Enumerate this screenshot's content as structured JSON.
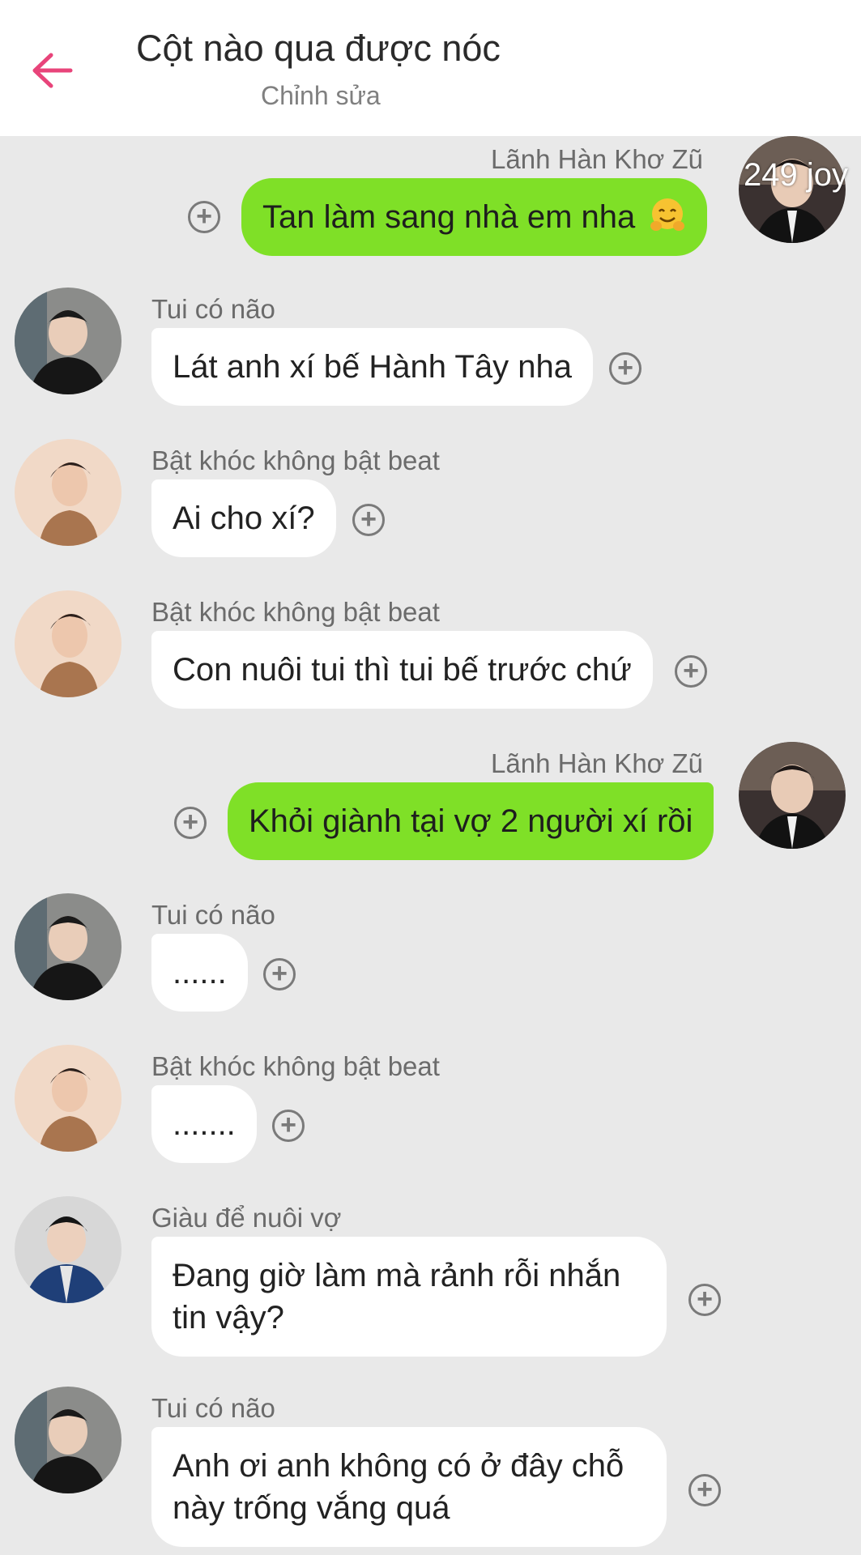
{
  "header": {
    "title": "Cột nào qua được nóc",
    "subtitle": "Chỉnh sửa",
    "accent_color": "#e8447a"
  },
  "colors": {
    "background": "#e9e9e9",
    "outgoing_bubble": "#7fe027",
    "incoming_bubble": "#ffffff"
  },
  "badge": {
    "text": "249 joy"
  },
  "messages": [
    {
      "sender": "Lãnh Hàn Khơ Zũ",
      "text": "Tan làm sang nhà em nha",
      "direction": "outgoing",
      "emoji": "hugging-face-emoji"
    },
    {
      "sender": "Tui có não",
      "text": "Lát anh xí bế Hành Tây nha",
      "direction": "incoming"
    },
    {
      "sender": "Bật khóc không bật beat",
      "text": "Ai cho xí?",
      "direction": "incoming"
    },
    {
      "sender": "Bật khóc không bật beat",
      "text": "Con nuôi tui thì tui bế trước chứ",
      "direction": "incoming"
    },
    {
      "sender": "Lãnh Hàn Khơ Zũ",
      "text": "Khỏi giành tại vợ 2 người xí rồi",
      "direction": "outgoing"
    },
    {
      "sender": "Tui có não",
      "text": "......",
      "direction": "incoming"
    },
    {
      "sender": "Bật khóc không bật beat",
      "text": ".......",
      "direction": "incoming"
    },
    {
      "sender": "Giàu để nuôi vợ",
      "text": "Đang giờ làm mà rảnh rỗi nhắn tin vậy?",
      "direction": "incoming"
    },
    {
      "sender": "Tui có não",
      "text": "Anh ơi anh không có ở đây chỗ này trống vắng quá",
      "direction": "incoming"
    }
  ],
  "icons": {
    "back": "arrow-left-icon",
    "reaction": "add-reaction-icon"
  }
}
